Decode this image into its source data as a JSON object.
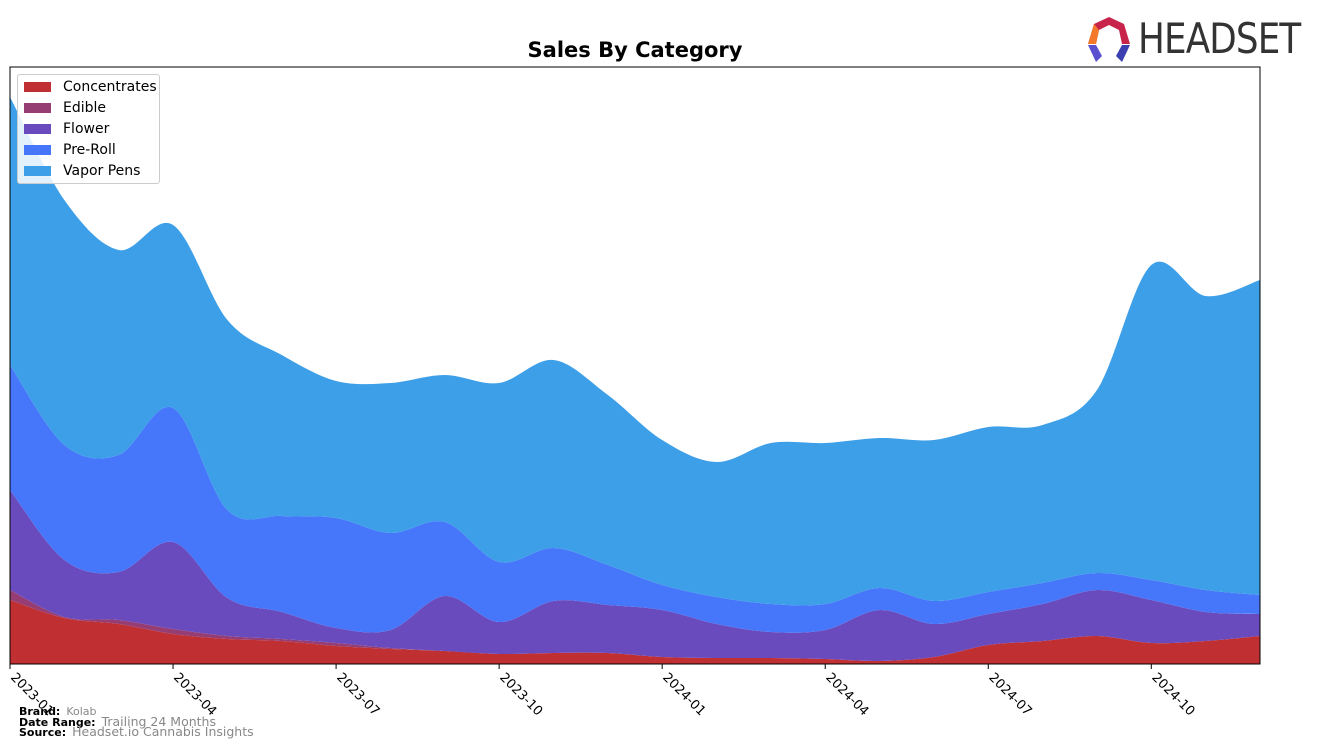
{
  "chart_data": {
    "type": "area",
    "stacked": true,
    "title": "Sales By Category",
    "xlabel": "",
    "ylabel": "",
    "x": [
      "2023-01",
      "2023-02",
      "2023-03",
      "2023-04",
      "2023-05",
      "2023-06",
      "2023-07",
      "2023-08",
      "2023-09",
      "2023-10",
      "2023-11",
      "2023-12",
      "2024-01",
      "2024-02",
      "2024-03",
      "2024-04",
      "2024-05",
      "2024-06",
      "2024-07",
      "2024-08",
      "2024-09",
      "2024-10",
      "2024-11",
      "2024-12"
    ],
    "xticks": [
      "2023-01",
      "2023-04",
      "2023-07",
      "2023-10",
      "2024-01",
      "2024-04",
      "2024-07",
      "2024-10"
    ],
    "ylim": [
      0,
      597
    ],
    "y_axis_visible": false,
    "grid": false,
    "legend_position": "top-left",
    "series": [
      {
        "name": "Concentrates",
        "color": "#c03033",
        "values": [
          64,
          46,
          40,
          30,
          25,
          23,
          18,
          15,
          13,
          10,
          11,
          11,
          7,
          6,
          6,
          5,
          3,
          7,
          19,
          23,
          28,
          21,
          23,
          28
        ]
      },
      {
        "name": "Edible",
        "color": "#963d73",
        "values": [
          10,
          1,
          4,
          5,
          3,
          2,
          3,
          1,
          0,
          0,
          0,
          0,
          0,
          0,
          0,
          0,
          0,
          0,
          0,
          0,
          0,
          0,
          0,
          0
        ]
      },
      {
        "name": "Flower",
        "color": "#6a4bbd",
        "values": [
          100,
          57,
          48,
          87,
          38,
          27,
          15,
          18,
          55,
          32,
          52,
          48,
          47,
          34,
          26,
          29,
          51,
          33,
          31,
          37,
          46,
          43,
          29,
          22
        ]
      },
      {
        "name": "Pre-Roll",
        "color": "#4676fa",
        "values": [
          125,
          115,
          117,
          134,
          88,
          96,
          110,
          97,
          74,
          60,
          53,
          40,
          25,
          27,
          28,
          26,
          22,
          23,
          22,
          21,
          17,
          20,
          22,
          19
        ]
      },
      {
        "name": "Vapor Pens",
        "color": "#3d9fe8",
        "values": [
          268,
          245,
          205,
          183,
          190,
          161,
          137,
          150,
          147,
          179,
          188,
          170,
          145,
          135,
          161,
          161,
          150,
          161,
          165,
          158,
          183,
          315,
          294,
          315
        ]
      }
    ]
  },
  "footer": {
    "brand_label": "Brand:",
    "brand_value": "Kolab",
    "range_label": "Date Range:",
    "range_value": "Trailing 24 Months",
    "source_label": "Source:",
    "source_value": "Headset.io Cannabis Insights"
  },
  "logo": {
    "text": "HEADSET"
  }
}
